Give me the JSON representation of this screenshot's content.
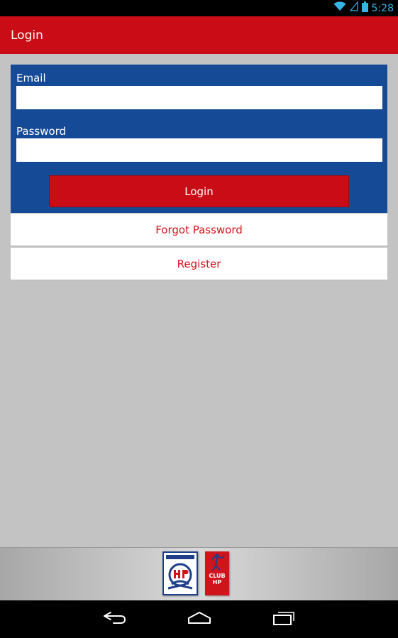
{
  "status_bar": {
    "time": "5:28",
    "icons": [
      "wifi-icon",
      "signal-icon",
      "battery-icon"
    ]
  },
  "app_bar": {
    "title": "Login"
  },
  "form": {
    "email_label": "Email",
    "email_value": "",
    "password_label": "Password",
    "password_value": "",
    "login_label": "Login"
  },
  "links": {
    "forgot_label": "Forgot Password",
    "register_label": "Register"
  },
  "footer": {
    "logos": [
      "hp-logo",
      "club-hp-logo"
    ],
    "club_text": "CLUB\nHP"
  },
  "nav_bar": {
    "icons": [
      "back-icon",
      "home-icon",
      "recent-apps-icon"
    ]
  },
  "colors": {
    "primary_red": "#c90c16",
    "form_blue": "#154a96",
    "link_red": "#d0141c",
    "status_blue": "#33b5e5",
    "background": "#c3c3c3"
  }
}
